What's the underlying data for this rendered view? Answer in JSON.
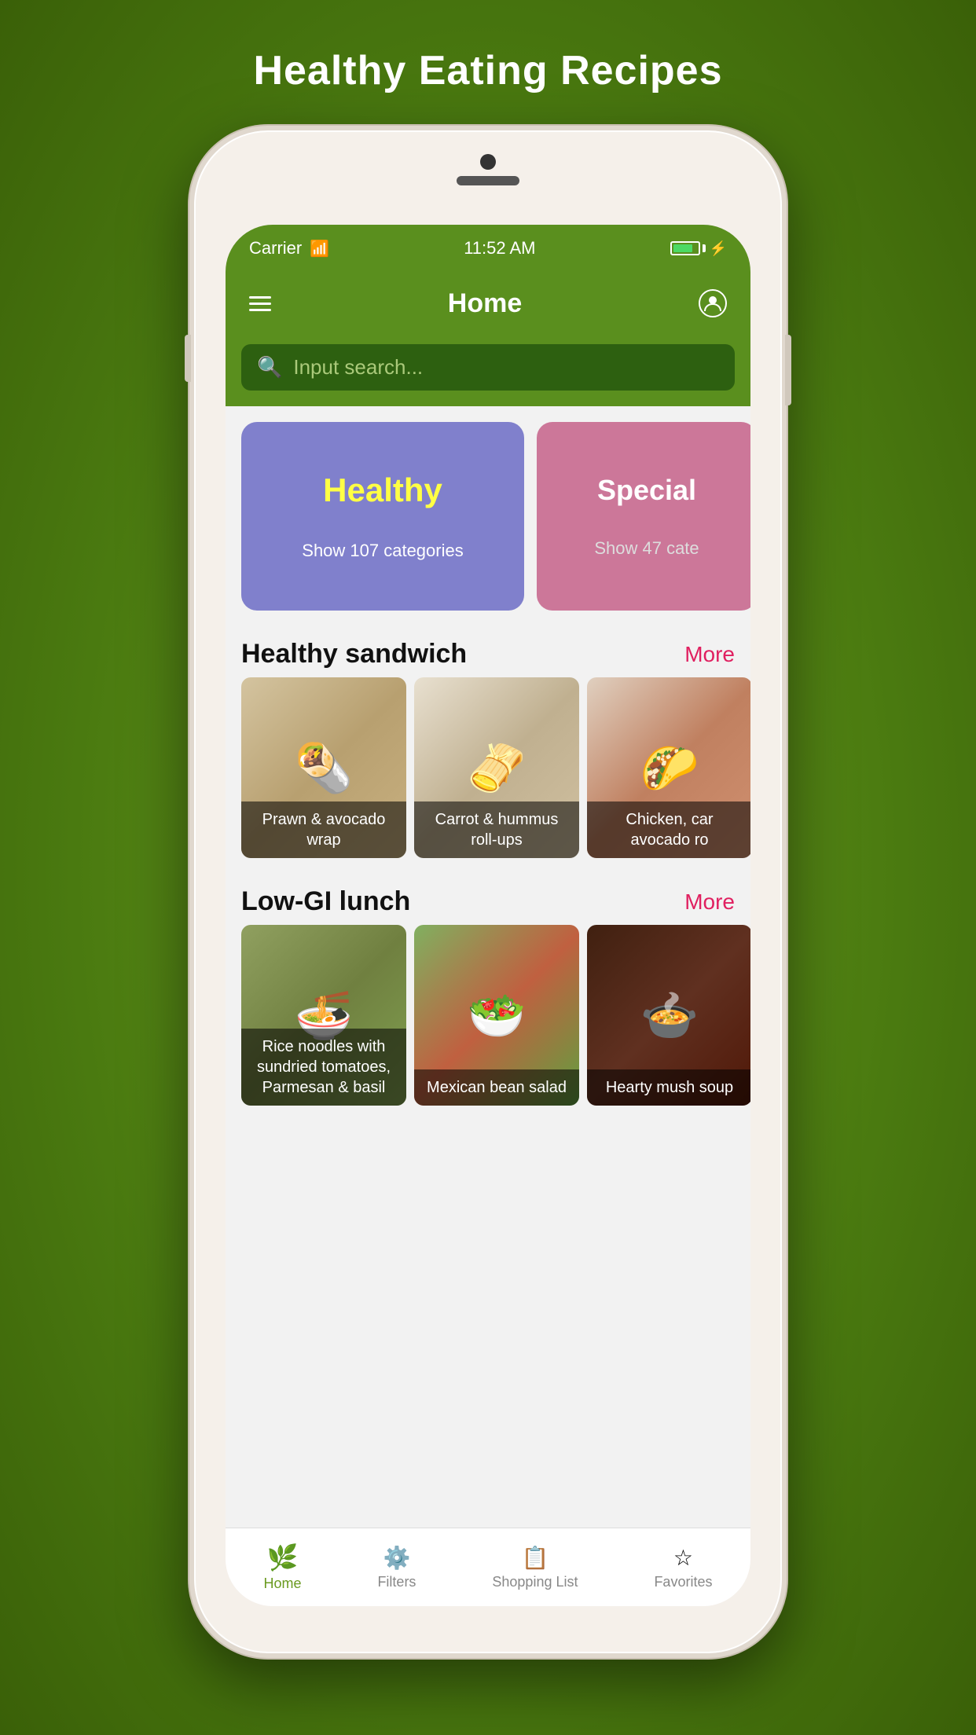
{
  "app": {
    "page_title": "Healthy Eating Recipes"
  },
  "status_bar": {
    "carrier": "Carrier",
    "time": "11:52 AM",
    "battery_level": "80"
  },
  "nav": {
    "title": "Home",
    "menu_icon": "☰",
    "user_icon": "user"
  },
  "search": {
    "placeholder": "Input search..."
  },
  "categories": [
    {
      "id": "healthy",
      "title": "Healthy",
      "subtitle": "Show 107 categories",
      "color": "#8080cc",
      "title_color": "#ffff44"
    },
    {
      "id": "special",
      "title": "Special",
      "subtitle": "Show 47 cate",
      "color": "#cc7799",
      "title_color": "#ffffff"
    }
  ],
  "sections": [
    {
      "id": "healthy-sandwich",
      "title": "Healthy sandwich",
      "more_label": "More",
      "recipes": [
        {
          "name": "Prawn &\navocado wrap",
          "emoji": "🌯"
        },
        {
          "name": "Carrot & hummus\nroll-ups",
          "emoji": "🫔"
        },
        {
          "name": "Chicken, car\navocado ro",
          "emoji": "🌮"
        }
      ]
    },
    {
      "id": "low-gi-lunch",
      "title": "Low-GI lunch",
      "more_label": "More",
      "recipes": [
        {
          "name": "Rice noodles with\nsundried tomatoes,\nParmesan & basil",
          "emoji": "🍜"
        },
        {
          "name": "Mexican bean salad",
          "emoji": "🥗"
        },
        {
          "name": "Hearty mush\nsoup",
          "emoji": "🍲"
        }
      ]
    }
  ],
  "bottom_nav": [
    {
      "id": "home",
      "label": "Home",
      "icon": "🌿",
      "active": true
    },
    {
      "id": "filters",
      "label": "Filters",
      "icon": "⚙",
      "active": false
    },
    {
      "id": "shopping-list",
      "label": "Shopping List",
      "icon": "📋",
      "active": false
    },
    {
      "id": "favorites",
      "label": "Favorites",
      "icon": "☆",
      "active": false
    }
  ]
}
